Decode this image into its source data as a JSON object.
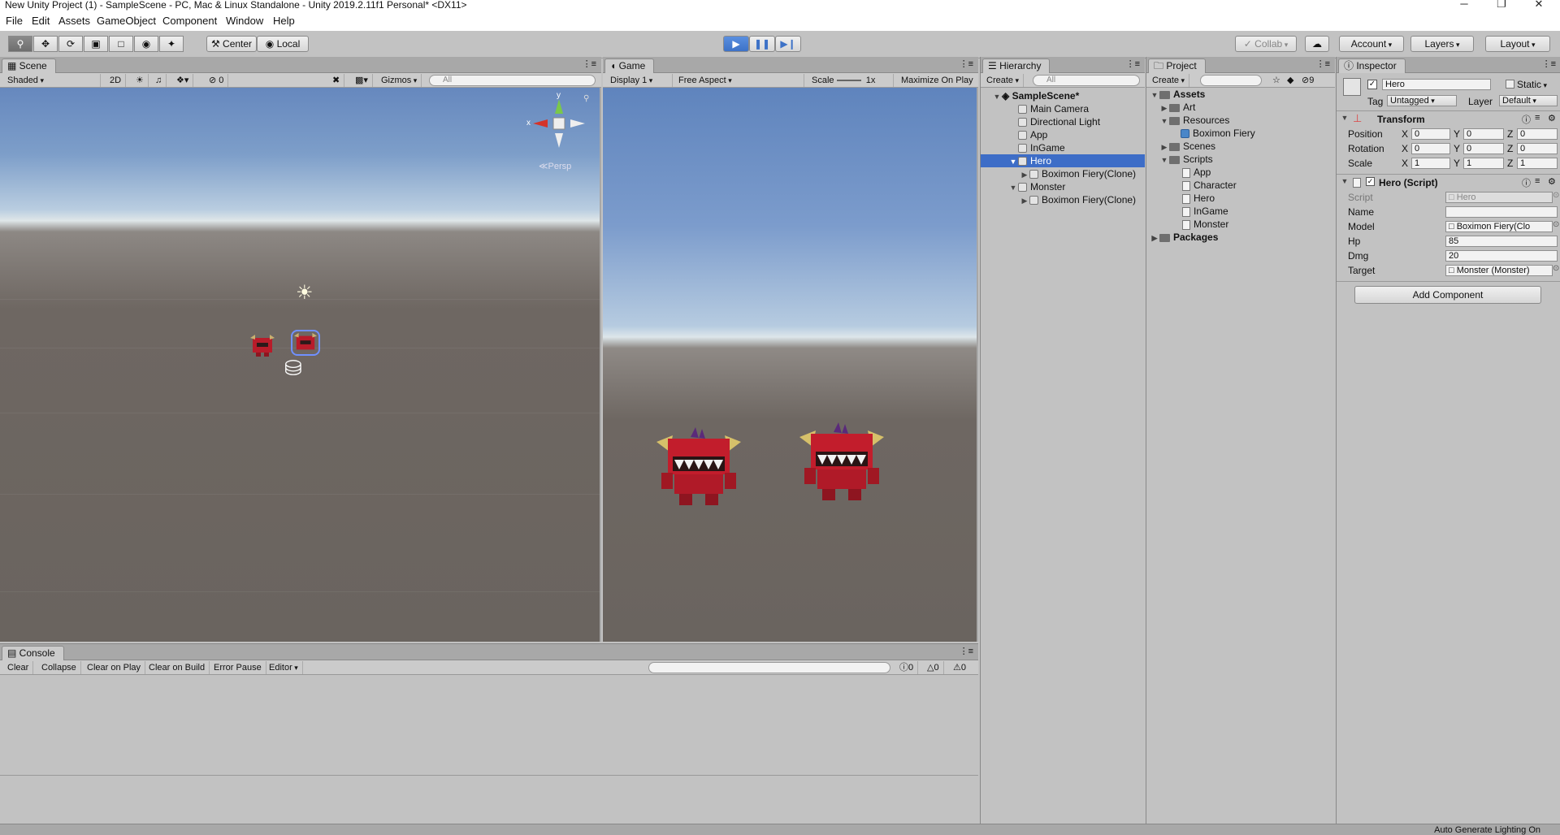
{
  "window": {
    "title": "New Unity Project (1) - SampleScene - PC, Mac & Linux Standalone - Unity 2019.2.11f1 Personal* <DX11>",
    "minimize": "─",
    "maximize": "❐",
    "close": "✕"
  },
  "menu": [
    "File",
    "Edit",
    "Assets",
    "GameObject",
    "Component",
    "Window",
    "Help"
  ],
  "toolbar": {
    "center": "Center",
    "local": "Local",
    "collab": "Collab",
    "account": "Account",
    "layers": "Layers",
    "layout": "Layout"
  },
  "scene": {
    "tab": "Scene",
    "shading": "Shaded",
    "mode2d": "2D",
    "fx_count": "0",
    "gizmos": "Gizmos",
    "search_placeholder": "All",
    "persp": "Persp",
    "axis_x": "x",
    "axis_y": "y"
  },
  "game": {
    "tab": "Game",
    "display": "Display 1",
    "aspect": "Free Aspect",
    "scale_label": "Scale",
    "scale_value": "1x",
    "maximize": "Maximize On Play"
  },
  "hierarchy": {
    "tab": "Hierarchy",
    "create": "Create",
    "search_placeholder": "All",
    "scene": "SampleScene*",
    "items": [
      "Main Camera",
      "Directional Light",
      "App",
      "InGame",
      "Hero",
      "Boximon Fiery(Clone)",
      "Monster",
      "Boximon Fiery(Clone)"
    ]
  },
  "project": {
    "tab": "Project",
    "create": "Create",
    "hidden_count": "9",
    "items": [
      "Assets",
      "Art",
      "Resources",
      "Boximon Fiery",
      "Scenes",
      "Scripts",
      "App",
      "Character",
      "Hero",
      "InGame",
      "Monster",
      "Packages"
    ]
  },
  "inspector": {
    "tab": "Inspector",
    "name": "Hero",
    "static_label": "Static",
    "tag_label": "Tag",
    "tag_value": "Untagged",
    "layer_label": "Layer",
    "layer_value": "Default",
    "transform": {
      "title": "Transform",
      "position": "Position",
      "rotation": "Rotation",
      "scale": "Scale",
      "x": "X",
      "y": "Y",
      "z": "Z",
      "pos": [
        "0",
        "0",
        "0"
      ],
      "rot": [
        "0",
        "0",
        "0"
      ],
      "scl": [
        "1",
        "1",
        "1"
      ]
    },
    "script": {
      "title": "Hero (Script)",
      "script_label": "Script",
      "script_value": "Hero",
      "name_label": "Name",
      "name_value": "",
      "model_label": "Model",
      "model_value": "Boximon Fiery(Clo",
      "hp_label": "Hp",
      "hp_value": "85",
      "dmg_label": "Dmg",
      "dmg_value": "20",
      "target_label": "Target",
      "target_value": "Monster (Monster)"
    },
    "add_component": "Add Component"
  },
  "console": {
    "tab": "Console",
    "clear": "Clear",
    "collapse": "Collapse",
    "clear_on_play": "Clear on Play",
    "clear_on_build": "Clear on Build",
    "error_pause": "Error Pause",
    "editor": "Editor",
    "info_count": "0",
    "warn_count": "0",
    "error_count": "0"
  },
  "status": {
    "text": "Auto Generate Lighting On"
  },
  "colors": {
    "accent": "#3d6dc7",
    "play": "#4a80d6",
    "sky_top": "#6a8fc4",
    "ground": "#6b645f"
  }
}
